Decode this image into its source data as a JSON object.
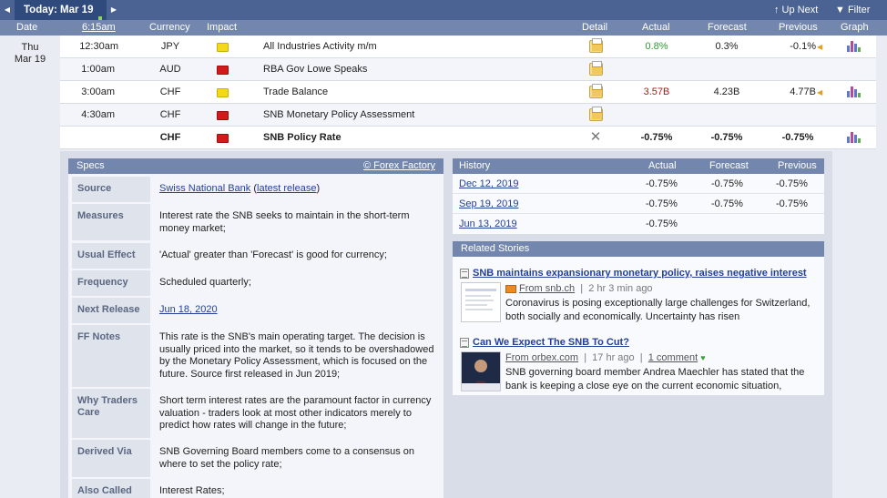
{
  "toolbar": {
    "today_label": "Today: Mar 19",
    "prev_glyph": "◀",
    "next_glyph": "▶",
    "up_next_label": "↑ Up Next",
    "filter_label": "▼ Filter"
  },
  "columns": {
    "date": "Date",
    "time": "6:15am",
    "currency": "Currency",
    "impact": "Impact",
    "detail": "Detail",
    "actual": "Actual",
    "forecast": "Forecast",
    "previous": "Previous",
    "graph": "Graph"
  },
  "day": {
    "weekday": "Thu",
    "date": "Mar 19"
  },
  "events": [
    {
      "time": "12:30am",
      "currency": "JPY",
      "impact": "yellow",
      "title": "All Industries Activity m/m",
      "actual": "0.8%",
      "forecast": "0.3%",
      "previous": "-0.1%",
      "has_graph": true
    },
    {
      "time": "1:00am",
      "currency": "AUD",
      "impact": "red",
      "title": "RBA Gov Lowe Speaks",
      "actual": "",
      "forecast": "",
      "previous": "",
      "has_graph": false
    },
    {
      "time": "3:00am",
      "currency": "CHF",
      "impact": "yellow",
      "title": "Trade Balance",
      "actual": "3.57B",
      "forecast": "4.23B",
      "previous": "4.77B",
      "has_graph": true
    },
    {
      "time": "4:30am",
      "currency": "CHF",
      "impact": "red",
      "title": "SNB Monetary Policy Assessment",
      "actual": "",
      "forecast": "",
      "previous": "",
      "has_graph": false
    },
    {
      "time": "",
      "currency": "CHF",
      "impact": "red",
      "title": "SNB Policy Rate",
      "actual": "-0.75%",
      "forecast": "-0.75%",
      "previous": "-0.75%",
      "has_graph": true
    }
  ],
  "specs": {
    "header": "Specs",
    "source_link": "© Forex Factory",
    "rows": [
      {
        "label": "Source",
        "value": "Swiss National Bank",
        "value_link2": "latest release"
      },
      {
        "label": "Measures",
        "value": "Interest rate the SNB seeks to maintain in the short-term money market;"
      },
      {
        "label": "Usual Effect",
        "value": "'Actual' greater than 'Forecast' is good for currency;"
      },
      {
        "label": "Frequency",
        "value": "Scheduled quarterly;"
      },
      {
        "label": "Next Release",
        "value": "Jun 18, 2020"
      },
      {
        "label": "FF Notes",
        "value": "This rate is the SNB's main operating target. The decision is usually priced into the market, so it tends to be overshadowed by the Monetary Policy Assessment, which is focused on the future. Source first released in Jun 2019;"
      },
      {
        "label": "Why Traders Care",
        "value": "Short term interest rates are the paramount factor in currency valuation - traders look at most other indicators merely to predict how rates will change in the future;"
      },
      {
        "label": "Derived Via",
        "value": "SNB Governing Board members come to a consensus on where to set the policy rate;"
      },
      {
        "label": "Also Called",
        "value": "Interest Rates;"
      }
    ]
  },
  "history": {
    "header": "History",
    "col_actual": "Actual",
    "col_forecast": "Forecast",
    "col_previous": "Previous",
    "rows": [
      {
        "date": "Dec 12, 2019",
        "actual": "-0.75%",
        "forecast": "-0.75%",
        "previous": "-0.75%"
      },
      {
        "date": "Sep 19, 2019",
        "actual": "-0.75%",
        "forecast": "-0.75%",
        "previous": "-0.75%"
      },
      {
        "date": "Jun 13, 2019",
        "actual": "-0.75%",
        "forecast": "",
        "previous": ""
      }
    ]
  },
  "stories": {
    "header": "Related Stories",
    "items": [
      {
        "title": "SNB maintains expansionary monetary policy, raises negative interest",
        "source": "From snb.ch",
        "age": "2 hr 3 min ago",
        "comments": "",
        "excerpt": "Coronavirus is posing exceptionally large challenges for Switzerland, both socially and economically. Uncertainty has risen"
      },
      {
        "title": "Can We Expect The SNB To Cut?",
        "source": "From orbex.com",
        "age": "17 hr ago",
        "comments": "1 comment",
        "excerpt": "SNB governing board member Andrea Maechler has stated that the bank is keeping a close eye on the current economic situation,"
      }
    ]
  },
  "colors": {
    "toolbar": "#4a6393",
    "header": "#7387ae",
    "impact_yellow": "#f3da19",
    "impact_red": "#d21a1a",
    "actual_better": "#2e9b2e",
    "actual_worse": "#b21b1b",
    "link": "#23409a"
  }
}
